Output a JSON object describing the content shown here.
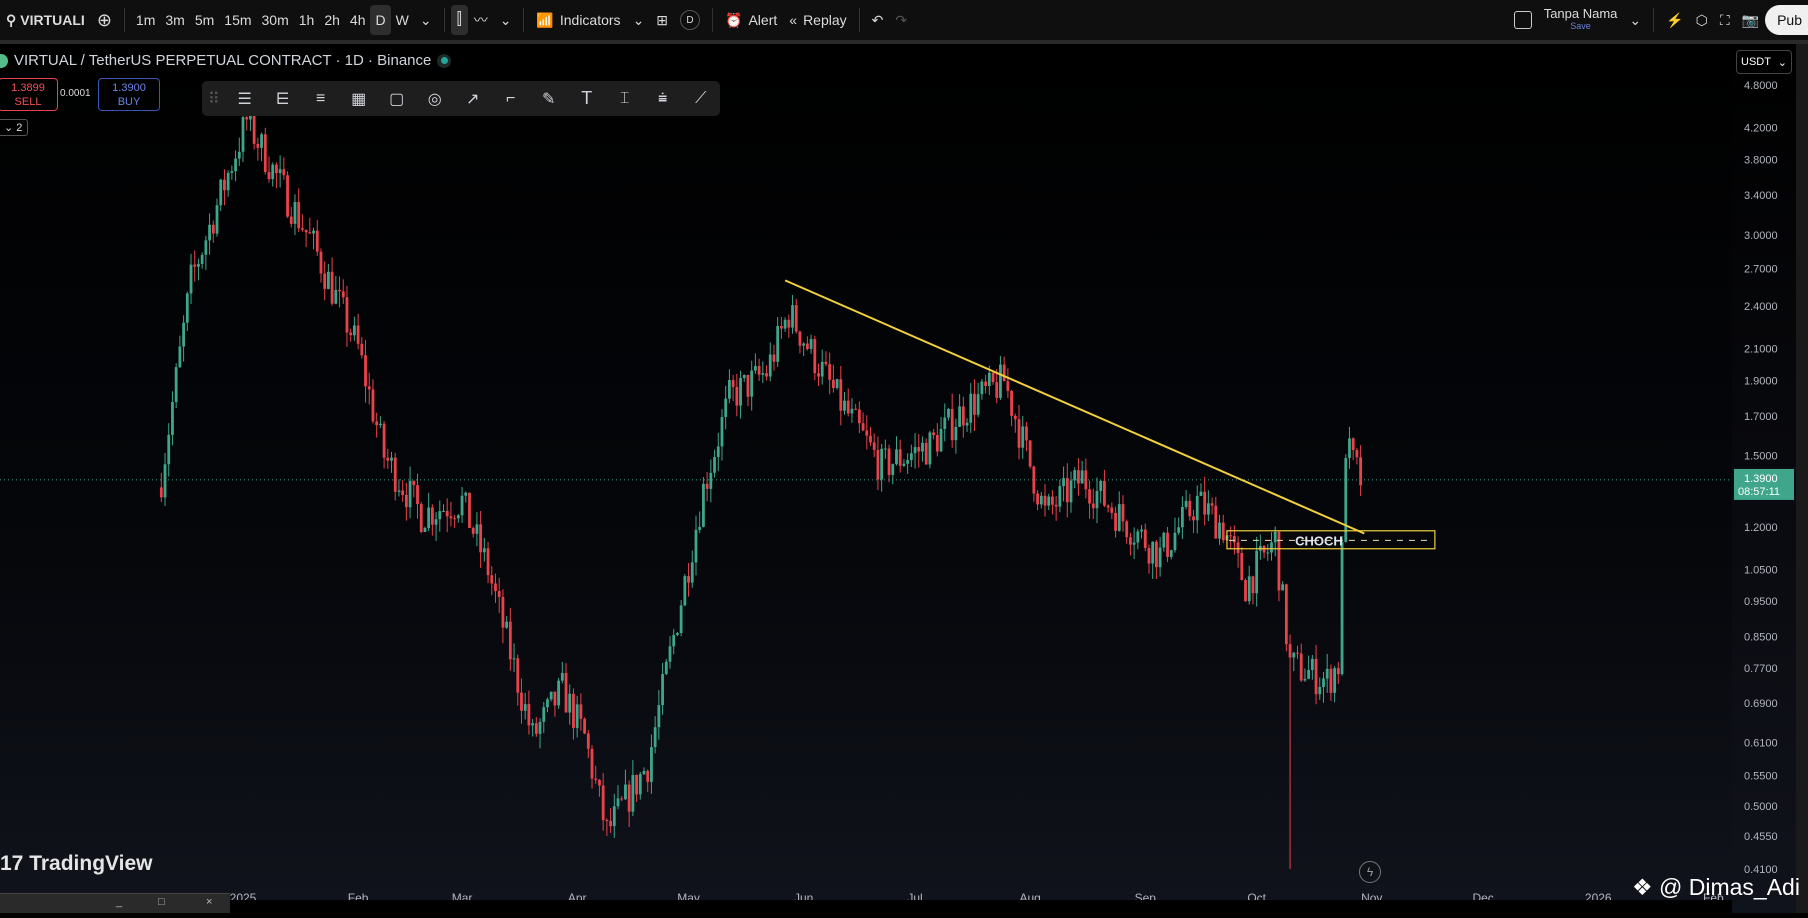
{
  "toolbar": {
    "symbol": "VIRTUALI",
    "intervals": [
      "1m",
      "3m",
      "5m",
      "15m",
      "30m",
      "1h",
      "2h",
      "4h",
      "D",
      "W"
    ],
    "active_interval": "D",
    "indicators_label": "Indicators",
    "alert_label": "Alert",
    "replay_label": "Replay",
    "layout_name": "Tanpa Nama",
    "save_label": "Save",
    "publish_label": "Pub",
    "d_badge": "D"
  },
  "legend": {
    "title": "VIRTUAL / TetherUS PERPETUAL CONTRACT · 1D · Binance",
    "status_color": "#26a69a"
  },
  "trade": {
    "sell_price": "1.3899",
    "sell_label": "SELL",
    "spread": "0.0001",
    "buy_price": "1.3900",
    "buy_label": "BUY",
    "indicator_count": "2"
  },
  "price_scale": {
    "currency": "USDT",
    "current_price": "1.3900",
    "countdown": "08:57:11"
  },
  "branding": {
    "logo": "TradingView",
    "watermark": "@ Dimas_Adi"
  },
  "colors": {
    "up": "#3fa58b",
    "down": "#e8424c",
    "trendline": "#f2d03b",
    "box": "#f2d03b",
    "background": "#000000"
  },
  "chart_data": {
    "type": "candlestick",
    "scale": "log",
    "ylim": [
      0.41,
      4.8
    ],
    "y_ticks": [
      "4.8000",
      "4.2000",
      "3.8000",
      "3.4000",
      "3.0000",
      "2.7000",
      "2.4000",
      "2.1000",
      "1.9000",
      "1.7000",
      "1.5000",
      "1.2000",
      "1.0500",
      "0.9500",
      "0.8500",
      "0.7700",
      "0.6900",
      "0.6100",
      "0.5500",
      "0.5000",
      "0.4550",
      "0.4100"
    ],
    "x_ticks": [
      "2025",
      "Feb",
      "Mar",
      "Apr",
      "May",
      "Jun",
      "Jul",
      "Aug",
      "Sep",
      "Oct",
      "Nov",
      "Dec",
      "2026",
      "Feb"
    ],
    "price_path": [
      [
        "2024-12-10",
        1.4
      ],
      [
        "2024-12-18",
        2.6
      ],
      [
        "2024-12-26",
        3.4
      ],
      [
        "2025-01-02",
        4.3
      ],
      [
        "2025-01-10",
        3.6
      ],
      [
        "2025-01-20",
        2.9
      ],
      [
        "2025-02-01",
        2.1
      ],
      [
        "2025-02-08",
        1.5
      ],
      [
        "2025-02-18",
        1.25
      ],
      [
        "2025-03-01",
        1.3
      ],
      [
        "2025-03-08",
        1.05
      ],
      [
        "2025-03-20",
        0.62
      ],
      [
        "2025-03-28",
        0.72
      ],
      [
        "2025-04-03",
        0.62
      ],
      [
        "2025-04-09",
        0.46
      ],
      [
        "2025-04-20",
        0.57
      ],
      [
        "2025-04-27",
        0.85
      ],
      [
        "2025-05-05",
        1.35
      ],
      [
        "2025-05-12",
        1.8
      ],
      [
        "2025-05-22",
        1.95
      ],
      [
        "2025-05-28",
        2.35
      ],
      [
        "2025-06-10",
        1.8
      ],
      [
        "2025-06-22",
        1.45
      ],
      [
        "2025-07-05",
        1.55
      ],
      [
        "2025-07-15",
        1.75
      ],
      [
        "2025-07-25",
        1.9
      ],
      [
        "2025-08-05",
        1.25
      ],
      [
        "2025-08-15",
        1.4
      ],
      [
        "2025-08-28",
        1.2
      ],
      [
        "2025-09-05",
        1.1
      ],
      [
        "2025-09-15",
        1.3
      ],
      [
        "2025-09-22",
        1.2
      ],
      [
        "2025-09-28",
        1.0
      ],
      [
        "2025-10-06",
        1.15
      ],
      [
        "2025-10-10",
        0.78
      ],
      [
        "2025-10-20",
        0.74
      ],
      [
        "2025-10-23",
        0.78
      ],
      [
        "2025-10-25",
        1.55
      ],
      [
        "2025-10-29",
        1.39
      ]
    ],
    "spike_lows": [
      [
        "2025-10-10",
        0.41
      ]
    ],
    "trendline": {
      "from": [
        "2025-05-27",
        2.6
      ],
      "to": [
        "2025-10-30",
        1.175
      ]
    },
    "annotations": [
      {
        "type": "box",
        "label": "CHOCH",
        "from": "2025-09-23",
        "to": "2025-11-18",
        "top": 1.185,
        "bottom": 1.12,
        "level": 1.15
      }
    ],
    "current_price": 1.39
  }
}
